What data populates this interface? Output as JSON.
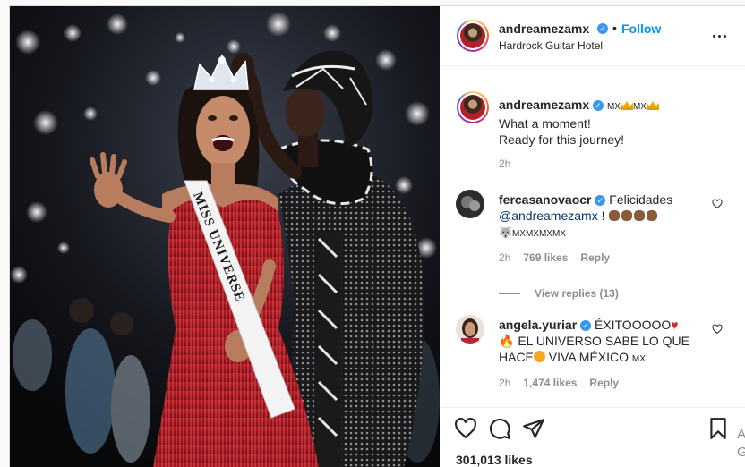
{
  "post": {
    "username": "andreamezamx",
    "follow_label": "Follow",
    "separator": "•",
    "location": "Hardrock Guitar Hotel",
    "caption": {
      "username": "andreamezamx",
      "flag_text_1": "MX",
      "flag_text_2": "MX",
      "line1": "What a moment!",
      "line2": "Ready for this journey!",
      "time": "2h"
    }
  },
  "comments": [
    {
      "username": "fercasanovaocr",
      "text": "Felicidades",
      "mention": "@andreamezamx",
      "suffix": "!",
      "line3": "MXMXMXMX",
      "time": "2h",
      "likes": "769 likes",
      "reply_label": "Reply",
      "view_replies": "View replies (13)"
    },
    {
      "username": "angela.yuriar",
      "text": "ÉXITOOOOO",
      "line2": "EL UNIVERSO SABE LO QUE",
      "line3a": "HACE",
      "line3b": "VIVA MÉXICO",
      "flag": "MX",
      "time": "2h",
      "likes": "1,474 likes",
      "reply_label": "Reply"
    }
  ],
  "engagement": {
    "likes": "301,013 likes",
    "edge_text_1": "Ac",
    "edge_text_2": "Go"
  },
  "photo": {
    "sash_text": "MISS UNIVERSE"
  },
  "colors": {
    "accent": "#0095f6",
    "verified": "#3897f0",
    "text": "#262626",
    "muted": "#8e8e8e",
    "dress": "#c0262e"
  }
}
